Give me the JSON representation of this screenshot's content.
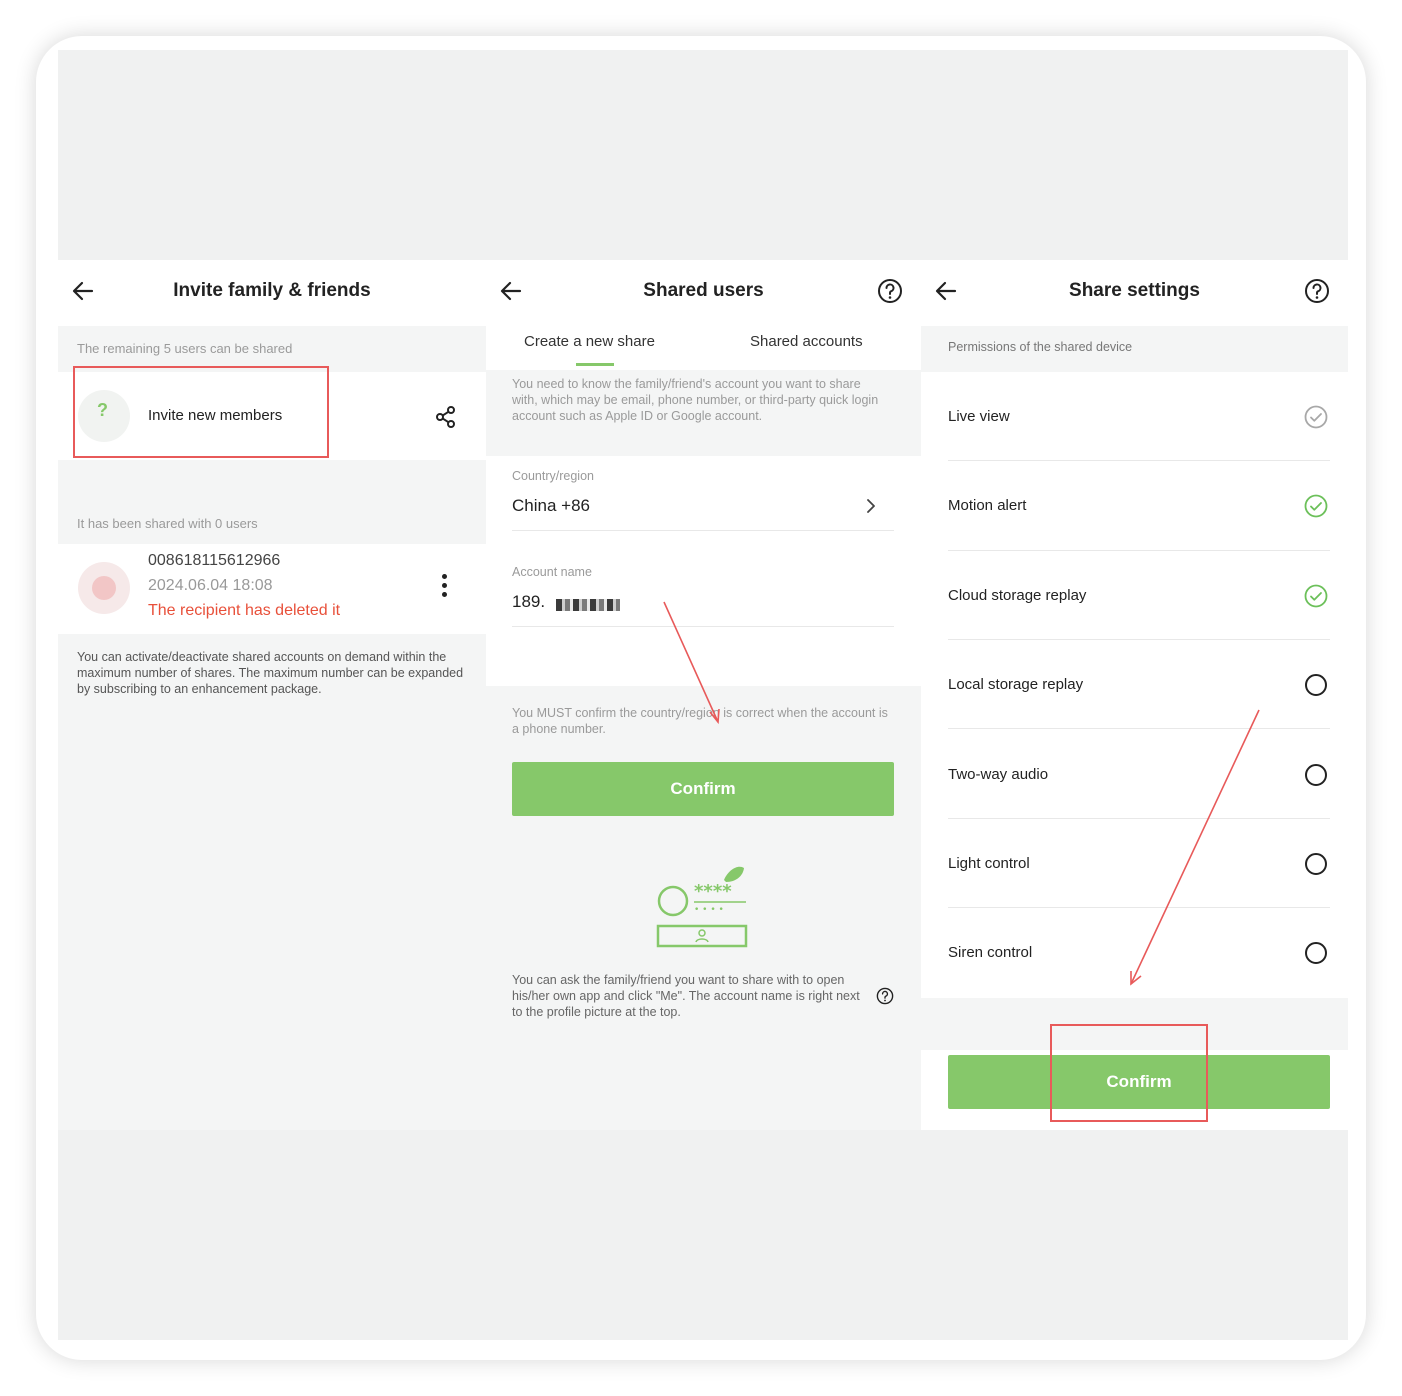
{
  "panel1": {
    "title": "Invite family & friends",
    "remaining_text": "The remaining 5 users can be shared",
    "invite_label": "Invite new members",
    "shared_count_text": "It has been shared with 0 users",
    "entry": {
      "account": "008618115612966",
      "date": "2024.06.04 18:08",
      "status": "The recipient has deleted it"
    },
    "note": "You can activate/deactivate shared accounts on demand within the maximum number of shares. The maximum number can be expanded by subscribing to an enhancement package."
  },
  "panel2": {
    "title": "Shared users",
    "tabs": [
      "Create a new share",
      "Shared accounts"
    ],
    "info": "You need to know the family/friend's account you want to share with, which may be email, phone number, or third-party quick login account such as Apple ID or Google account.",
    "country_label": "Country/region",
    "country_value": "China +86",
    "account_label": "Account name",
    "account_value": "189.",
    "warning": "You MUST confirm the country/region is correct when the account is a phone number.",
    "confirm_label": "Confirm",
    "illustration_text": "****",
    "bottom_note": "You can ask the family/friend you want to share with to open his/her own app and click \"Me\". The account name is right next to the profile picture at the top."
  },
  "panel3": {
    "title": "Share settings",
    "permissions_header": "Permissions of the shared device",
    "permissions": [
      {
        "label": "Live view",
        "state": "checked-grey"
      },
      {
        "label": "Motion alert",
        "state": "checked-green"
      },
      {
        "label": "Cloud storage replay",
        "state": "checked-green"
      },
      {
        "label": "Local storage replay",
        "state": "unchecked"
      },
      {
        "label": "Two-way audio",
        "state": "unchecked"
      },
      {
        "label": "Light control",
        "state": "unchecked"
      },
      {
        "label": "Siren control",
        "state": "unchecked"
      }
    ],
    "confirm_label": "Confirm"
  },
  "colors": {
    "accent_green": "#86c86a",
    "check_green": "#6cc05a",
    "annotation_red": "#e85a5a",
    "status_red": "#e8503a"
  }
}
